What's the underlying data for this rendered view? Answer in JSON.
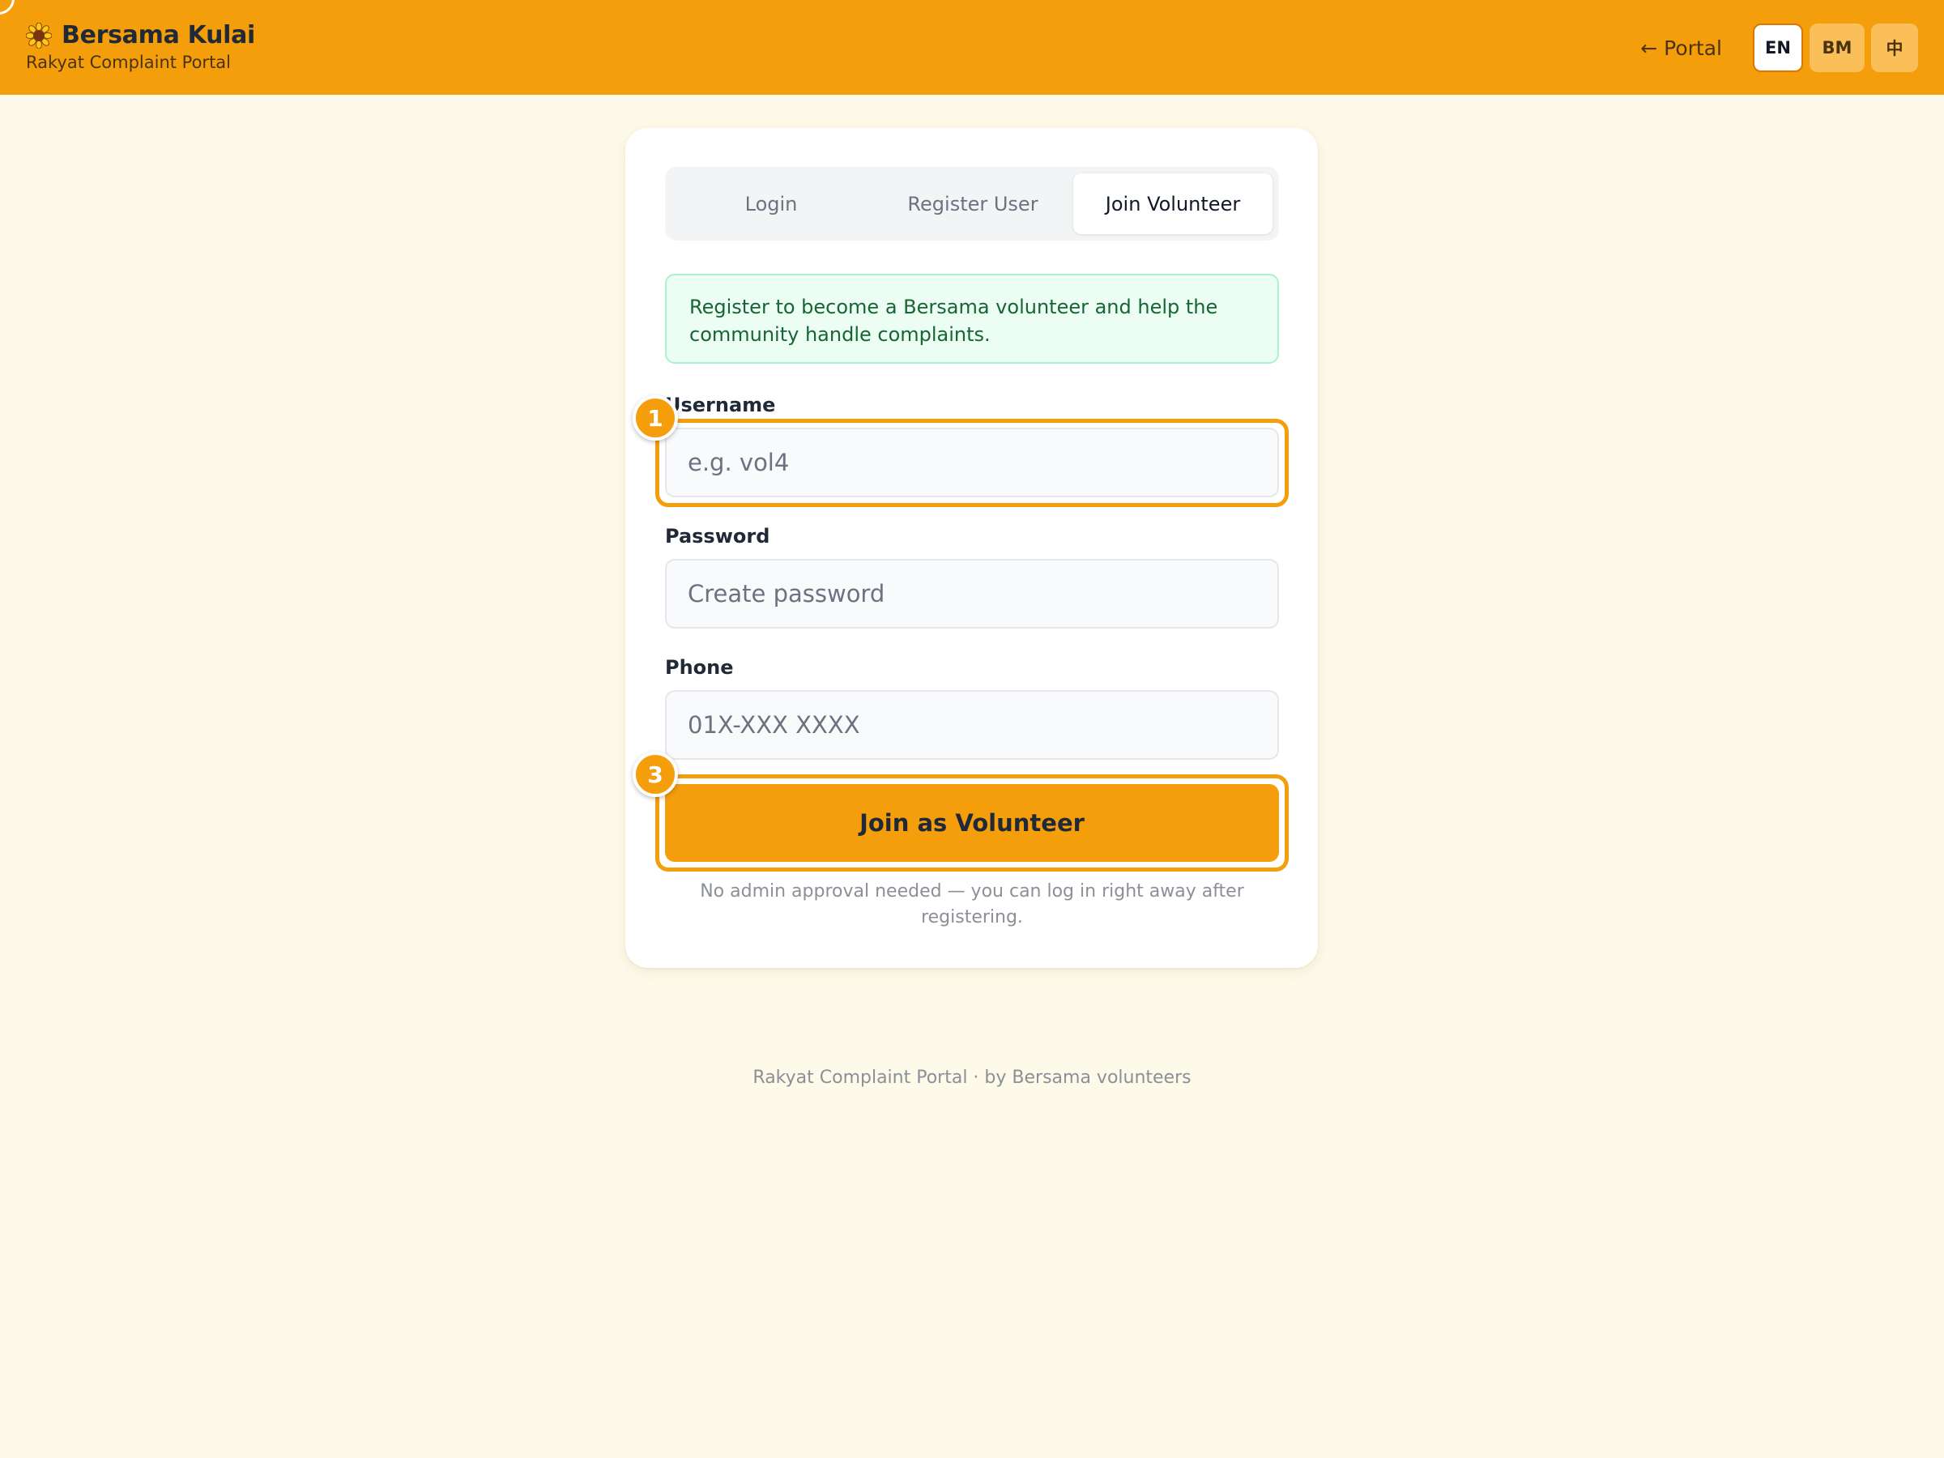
{
  "header": {
    "app_title": "Bersama Kulai",
    "app_subtitle": "Rakyat Complaint Portal",
    "logo_icon": "sunflower-icon",
    "portal_link": "← Portal",
    "languages": [
      "EN",
      "BM",
      "中"
    ],
    "active_language": "EN"
  },
  "auth": {
    "tabs": [
      "Login",
      "Register User",
      "Join Volunteer"
    ],
    "active_tab": "Join Volunteer",
    "info_message": "Register to become a Bersama volunteer and help the community handle complaints.",
    "fields": {
      "username": {
        "label": "Username",
        "placeholder": "e.g. vol4",
        "value": ""
      },
      "password": {
        "label": "Password",
        "placeholder": "Create password",
        "value": ""
      },
      "phone": {
        "label": "Phone",
        "placeholder": "01X-XXX XXXX",
        "value": ""
      }
    },
    "submit_label": "Join as Volunteer",
    "note": "No admin approval needed — you can log in right away after registering."
  },
  "annotations": [
    {
      "number": "1",
      "target": "username-input"
    },
    {
      "number": "3",
      "target": "join-volunteer-button"
    }
  ],
  "footer": {
    "text": "Rakyat Complaint Portal · by Bersama volunteers"
  },
  "colors": {
    "brand": "#f59e0b",
    "page_background": "#fefae9",
    "info_background": "#ecfdf3",
    "info_text": "#166534"
  }
}
